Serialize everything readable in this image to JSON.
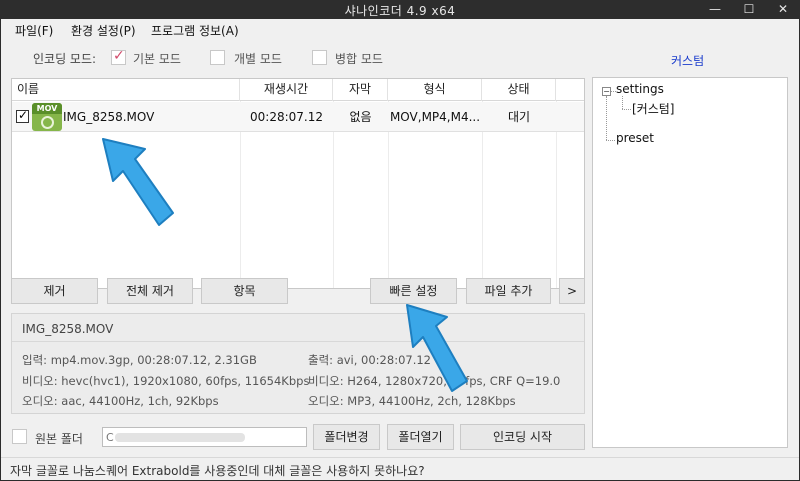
{
  "window": {
    "title": "샤나인코더  4.9  x64",
    "minimize_label": "—",
    "restore_label": "☐",
    "close_label": "✕"
  },
  "menu": {
    "items": [
      "파일(F)",
      "환경 설정(P)",
      "프로그램 정보(A)"
    ]
  },
  "encoding_mode": {
    "label": "인코딩 모드:",
    "options": [
      {
        "label": "기본 모드",
        "checked": true
      },
      {
        "label": "개별 모드",
        "checked": false
      },
      {
        "label": "병합 모드",
        "checked": false
      }
    ]
  },
  "custom_link": "커스텀",
  "file_table": {
    "columns": [
      "이름",
      "재생시간",
      "자막",
      "형식",
      "상태"
    ],
    "rows": [
      {
        "checked": true,
        "icon": "mov-file-icon",
        "icon_tag": "MOV",
        "name": "IMG_8258.MOV",
        "duration": "00:28:07.12",
        "subtitle": "없음",
        "format": "MOV,MP4,M4...",
        "status": "대기"
      }
    ]
  },
  "list_buttons": {
    "remove": "제거",
    "remove_all": "전체 제거",
    "items": "항목",
    "quick_settings": "빠른 설정",
    "add_file": "파일 추가",
    "more": ">"
  },
  "info": {
    "filename": "IMG_8258.MOV",
    "input": "입력: mp4.mov.3gp, 00:28:07.12, 2.31GB",
    "input_video": "비디오: hevc(hvc1), 1920x1080, 60fps, 11654Kbps",
    "input_audio": "오디오: aac, 44100Hz, 1ch, 92Kbps",
    "output": "출력: avi, 00:28:07.12",
    "output_video": "비디오: H264, 1280x720, 60fps, CRF Q=19.0",
    "output_audio": "오디오: MP3, 44100Hz, 2ch, 128Kbps"
  },
  "output_folder": {
    "source_folder_label": "원본 폴더",
    "source_folder_checked": false,
    "path_visible_prefix": "C",
    "change_folder": "폴더변경",
    "open_folder": "폴더열기",
    "start_encoding": "인코딩 시작"
  },
  "tree": {
    "root": "settings",
    "child": "[커스텀]",
    "sibling": "preset",
    "expand_symbol": "−"
  },
  "status": {
    "text": "자막 글꼴로 나눔스퀘어 Extrabold를 사용중인데 대체 글꼴은 사용하지 못하나요?"
  },
  "colors": {
    "accent_link": "#1a3ccc",
    "check_mark": "#d14a6a",
    "annotation_arrow": "#3aa7e8",
    "mov_icon": "#86b64a"
  }
}
